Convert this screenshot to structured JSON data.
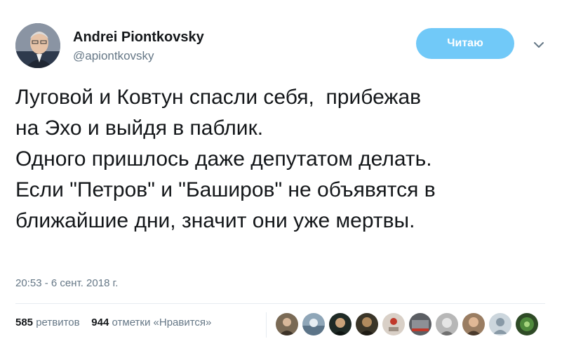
{
  "author": {
    "display_name": "Andrei Piontkovsky",
    "handle": "@apiontkovsky",
    "avatar_icon": "author-avatar"
  },
  "follow_button": {
    "label": "Читаю"
  },
  "more_menu": {
    "icon": "chevron-down-icon"
  },
  "tweet": {
    "lines": [
      "Луговой и Ковтун спасли себя,  прибежав",
      "на Эхо и выйдя в паблик.",
      "Одного пришлось даже депутатом делать.",
      "",
      "Если \"Петров\" и \"Баширов\" не объявятся в",
      "ближайшие дни, значит они уже мертвы."
    ],
    "timestamp": "20:53 - 6 сент. 2018 г."
  },
  "stats": {
    "retweets_count": "585",
    "retweets_label": "ретвитов",
    "likes_count": "944",
    "likes_label": "отметки «Нравится»"
  },
  "likers": [
    {
      "icon": "liker-avatar-1",
      "color": "#7a6a55"
    },
    {
      "icon": "liker-avatar-2",
      "color": "#8fa6b8"
    },
    {
      "icon": "liker-avatar-3",
      "color": "#1f2a26"
    },
    {
      "icon": "liker-avatar-4",
      "color": "#3a3528"
    },
    {
      "icon": "liker-avatar-5",
      "color": "#d9d0c7"
    },
    {
      "icon": "liker-avatar-6",
      "color": "#5b5e63"
    },
    {
      "icon": "liker-avatar-7",
      "color": "#b7b7b7"
    },
    {
      "icon": "liker-avatar-8",
      "color": "#9a7d62"
    },
    {
      "icon": "liker-avatar-default",
      "color": "#ccd6dd"
    },
    {
      "icon": "liker-avatar-9",
      "color": "#2e4a26"
    }
  ]
}
